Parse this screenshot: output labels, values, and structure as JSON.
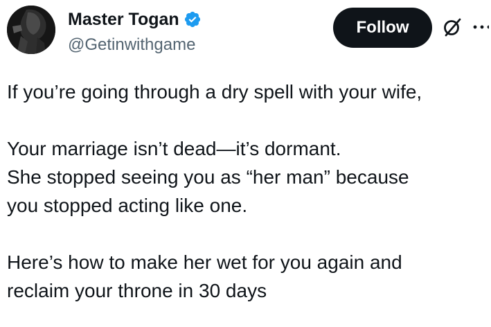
{
  "author": {
    "display_name": "Master Togan",
    "handle": "@Getinwithgame",
    "verified": true
  },
  "actions": {
    "follow_label": "Follow",
    "grok_icon": "grok-icon",
    "more_icon": "more-icon"
  },
  "tweet": {
    "lines": [
      "If you’re going through a dry spell with your wife,",
      "Your marriage isn’t dead—it’s dormant.",
      "She stopped seeing you as “her man” because",
      "you stopped acting like one.",
      "Here’s how to make her wet for you again and",
      "reclaim your throne in 30 days"
    ]
  },
  "colors": {
    "text": "#0f1419",
    "secondary": "#536471",
    "verified": "#1d9bf0",
    "button_bg": "#0f1419",
    "button_text": "#ffffff"
  }
}
